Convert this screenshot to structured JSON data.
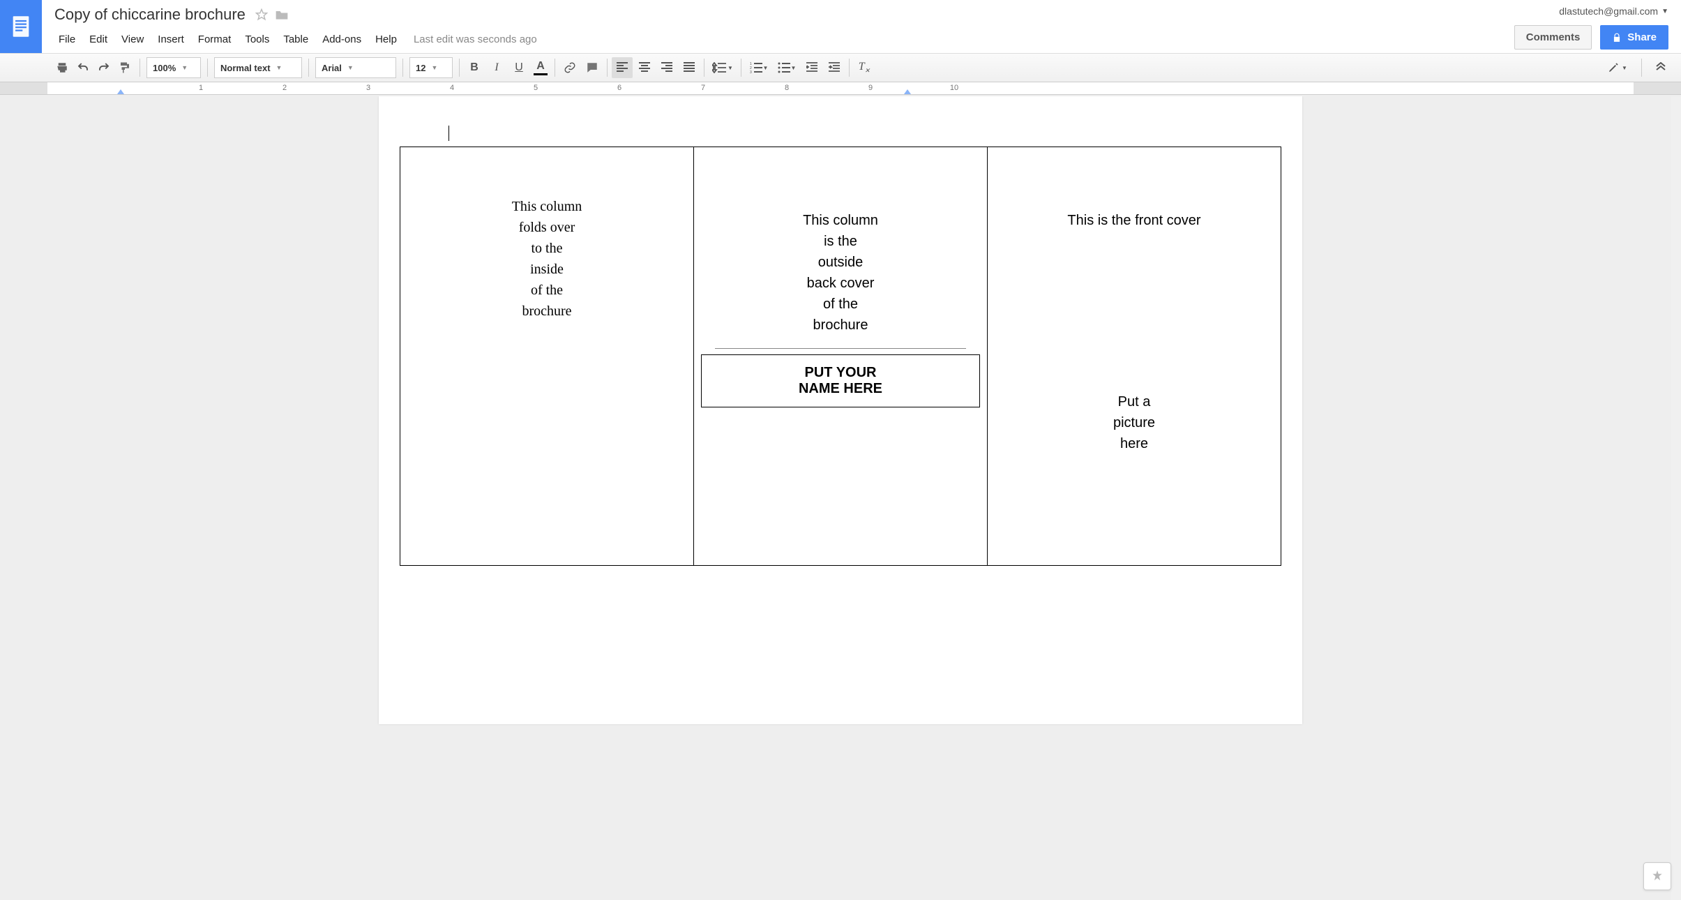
{
  "header": {
    "title": "Copy of chiccarine brochure",
    "account": "dlastutech@gmail.com"
  },
  "menu": {
    "file": "File",
    "edit": "Edit",
    "view": "View",
    "insert": "Insert",
    "format": "Format",
    "tools": "Tools",
    "table": "Table",
    "addons": "Add-ons",
    "help": "Help",
    "last_edit": "Last edit was seconds ago"
  },
  "buttons": {
    "comments": "Comments",
    "share": "Share"
  },
  "toolbar": {
    "zoom": "100%",
    "styles": "Normal text",
    "font": "Arial",
    "size": "12"
  },
  "ruler": {
    "marks": [
      "1",
      "2",
      "3",
      "4",
      "5",
      "6",
      "7",
      "8",
      "9",
      "10"
    ]
  },
  "doc": {
    "col1": {
      "l1": "This column",
      "l2": "folds over",
      "l3": "to the",
      "l4": "inside",
      "l5": "of the",
      "l6": "brochure"
    },
    "col2": {
      "l1": "This column",
      "l2": "is the",
      "l3": "outside",
      "l4": "back cover",
      "l5": "of the",
      "l6": "brochure",
      "name1": "PUT YOUR",
      "name2": "NAME HERE"
    },
    "col3": {
      "title": "This is the front cover",
      "p1": "Put a",
      "p2": "picture",
      "p3": "here"
    }
  }
}
